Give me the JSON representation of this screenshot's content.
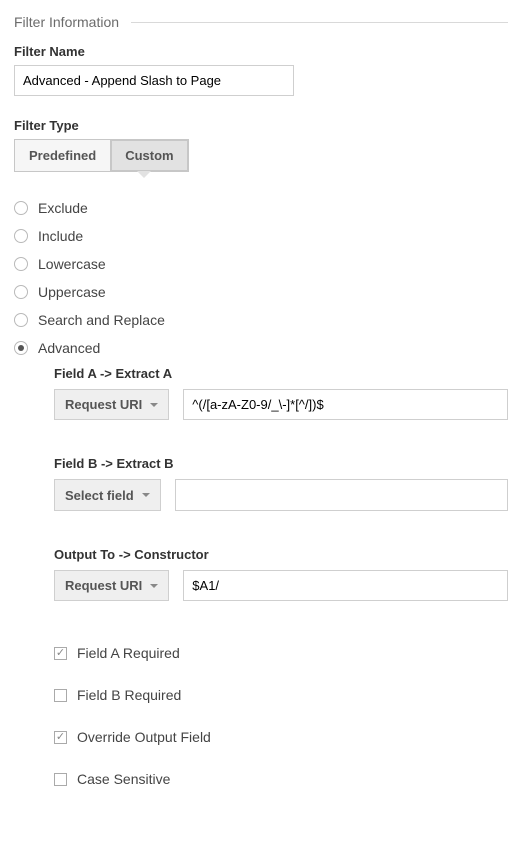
{
  "fieldset_title": "Filter Information",
  "filter_name": {
    "label": "Filter Name",
    "value": "Advanced - Append Slash to Page"
  },
  "filter_type": {
    "label": "Filter Type",
    "tabs": {
      "predefined": "Predefined",
      "custom": "Custom"
    },
    "active_tab": "custom"
  },
  "filter_modes": {
    "items": [
      {
        "label": "Exclude",
        "selected": false
      },
      {
        "label": "Include",
        "selected": false
      },
      {
        "label": "Lowercase",
        "selected": false
      },
      {
        "label": "Uppercase",
        "selected": false
      },
      {
        "label": "Search and Replace",
        "selected": false
      },
      {
        "label": "Advanced",
        "selected": true
      }
    ]
  },
  "advanced": {
    "field_a": {
      "title": "Field A -> Extract A",
      "select": "Request URI",
      "value": "^(/[a-zA-Z0-9/_\\-]*[^/])$"
    },
    "field_b": {
      "title": "Field B -> Extract B",
      "select": "Select field",
      "value": ""
    },
    "output": {
      "title": "Output To -> Constructor",
      "select": "Request URI",
      "value": "$A1/"
    },
    "checks": [
      {
        "key": "field_a_required",
        "label": "Field A Required",
        "checked": true
      },
      {
        "key": "field_b_required",
        "label": "Field B Required",
        "checked": false
      },
      {
        "key": "override_output",
        "label": "Override Output Field",
        "checked": true
      },
      {
        "key": "case_sensitive",
        "label": "Case Sensitive",
        "checked": false
      }
    ]
  }
}
